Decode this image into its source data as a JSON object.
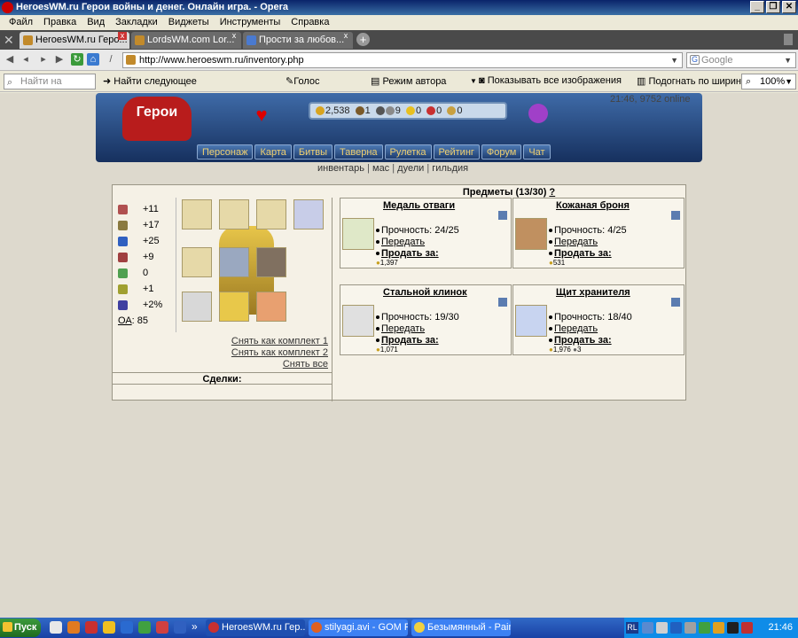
{
  "window": {
    "title": "HeroesWM.ru Герои войны и денег. Онлайн игра. - Opera",
    "buttons": [
      "_",
      "❐",
      "✕"
    ]
  },
  "menu": [
    "Файл",
    "Правка",
    "Вид",
    "Закладки",
    "Виджеты",
    "Инструменты",
    "Справка"
  ],
  "tabs": [
    {
      "label": "HeroesWM.ru Геро..."
    },
    {
      "label": "LordsWM.com Lor..."
    },
    {
      "label": "Прости за любов..."
    }
  ],
  "address": {
    "url": "http://www.heroeswm.ru/inventory.php",
    "search_placeholder": "Google"
  },
  "findbar": {
    "placeholder": "Найти на страниц",
    "find_next": "Найти следующее",
    "voice": "Голос",
    "author_mode": "Режим автора",
    "show_images": "Показывать все изображения",
    "fit_width": "Подогнать по ширине",
    "zoom": "100%"
  },
  "header": {
    "logo_text": "Герои",
    "resources": [
      "2,538",
      "1",
      "9",
      "0",
      "0",
      "0"
    ],
    "resource_colors": [
      "#d8a420",
      "#7a5a2a",
      "#555555",
      "#8a8a8a",
      "#e8c020",
      "#c83030",
      "#c8a040"
    ],
    "online": "21:46, 9752 online"
  },
  "nav": [
    "Персонаж",
    "Карта",
    "Битвы",
    "Таверна",
    "Рулетка",
    "Рейтинг",
    "Форум",
    "Чат"
  ],
  "subnav": [
    "инвентарь",
    "мас",
    "дуели",
    "гильдия"
  ],
  "stats": [
    {
      "icon": "attack-icon",
      "color": "#b05050",
      "value": "+11"
    },
    {
      "icon": "defense-icon",
      "color": "#8a7a40",
      "value": "+17"
    },
    {
      "icon": "magic-power-icon",
      "color": "#3060c0",
      "value": "+25"
    },
    {
      "icon": "knowledge-icon",
      "color": "#a04040",
      "value": "+9"
    },
    {
      "icon": "luck-icon",
      "color": "#50a050",
      "value": "0"
    },
    {
      "icon": "morale-icon",
      "color": "#a0a030",
      "value": "+1"
    },
    {
      "icon": "initiative-icon",
      "color": "#4040a0",
      "value": "+2%"
    }
  ],
  "oa": {
    "label": "ОА",
    "value": "85"
  },
  "sets": [
    "Снять как комплект 1",
    "Снять как комплект 2",
    "Снять все"
  ],
  "deals_label": "Сделки:",
  "items": {
    "title": "Предметы (13/30)",
    "help": "?",
    "list": [
      {
        "name": "Медаль отваги",
        "durability": "Прочность: 24/25",
        "transfer": "Передать",
        "sell": "Продать за:",
        "price": "1,397",
        "extra": ""
      },
      {
        "name": "Кожаная броня",
        "durability": "Прочность: 4/25",
        "transfer": "Передать",
        "sell": "Продать за:",
        "price": "531",
        "extra": ""
      },
      {
        "name": "Стальной клинок",
        "durability": "Прочность: 19/30",
        "transfer": "Передать",
        "sell": "Продать за:",
        "price": "1,071",
        "extra": ""
      },
      {
        "name": "Щит хранителя",
        "durability": "Прочность: 18/40",
        "transfer": "Передать",
        "sell": "Продать за:",
        "price": "1,976",
        "extra": "3"
      }
    ]
  },
  "taskbar": {
    "start": "Пуск",
    "more": "»",
    "tasks": [
      "HeroesWM.ru Гер...",
      "stilyagi.avi - GOM P...",
      "Безымянный - Paint"
    ],
    "tray_label": "RL",
    "clock": "21:46"
  }
}
